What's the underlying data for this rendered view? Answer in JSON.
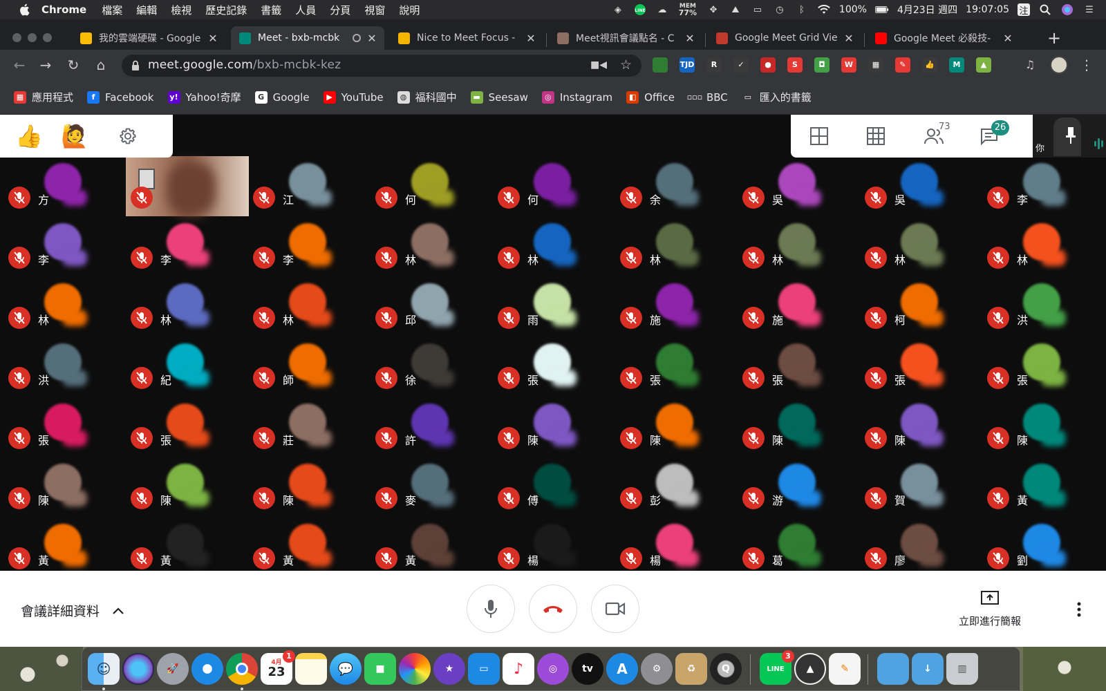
{
  "menubar": {
    "app": "Chrome",
    "items": [
      "檔案",
      "編輯",
      "檢視",
      "歷史記錄",
      "書籤",
      "人員",
      "分頁",
      "視窗",
      "說明"
    ],
    "mem_label": "MEM",
    "mem_value": "77%",
    "battery": "100%",
    "date": "4月23日 週四",
    "time": "19:07:05",
    "input_method": "注"
  },
  "tabs": [
    {
      "title": "我的雲端硬碟 - Google",
      "favicon_color": "#fbbc04"
    },
    {
      "title": "Meet - bxb-mcbk",
      "favicon_color": "#00897b",
      "active": true
    },
    {
      "title": "Nice to Meet Focus -",
      "favicon_color": "#f4b400"
    },
    {
      "title": "Meet視訊會議點名 - C",
      "favicon_color": "#8d6e63"
    },
    {
      "title": "Google Meet Grid Vie",
      "favicon_color": "#c0392b"
    },
    {
      "title": "Google Meet 必殺技-",
      "favicon_color": "#ff0000"
    }
  ],
  "omnibox": {
    "host": "meet.google.com",
    "path": "/bxb-mcbk-kez"
  },
  "extensions": [
    {
      "label": "",
      "color": "#2e7d32"
    },
    {
      "label": "TJD",
      "color": "#1565c0"
    },
    {
      "label": "R",
      "color": "#3a3a3a"
    },
    {
      "label": "✓",
      "color": "#3a3a3a"
    },
    {
      "label": "●",
      "color": "#c62828"
    },
    {
      "label": "S",
      "color": "#e53935"
    },
    {
      "label": "◘",
      "color": "#43a047"
    },
    {
      "label": "W",
      "color": "#e53935"
    },
    {
      "label": "▦",
      "color": "#3a3a3a"
    },
    {
      "label": "✎",
      "color": "#e53935"
    },
    {
      "label": "👍",
      "color": "#3a3a3a"
    },
    {
      "label": "M",
      "color": "#00897b"
    },
    {
      "label": "▲",
      "color": "#7cb342"
    }
  ],
  "bookmarks": [
    {
      "label": "應用程式",
      "icon_color": "#e53935",
      "glyph": "▦"
    },
    {
      "label": "Facebook",
      "icon_color": "#1877f2",
      "glyph": "f"
    },
    {
      "label": "Yahoo!奇摩",
      "icon_color": "#6001d2",
      "glyph": "y!"
    },
    {
      "label": "Google",
      "icon_color": "#ffffff",
      "glyph": "G"
    },
    {
      "label": "YouTube",
      "icon_color": "#ff0000",
      "glyph": "▶"
    },
    {
      "label": "福科國中",
      "icon_color": "#dddddd",
      "glyph": "◍"
    },
    {
      "label": "Seesaw",
      "icon_color": "#7cb342",
      "glyph": "▬"
    },
    {
      "label": "Instagram",
      "icon_color": "#c13584",
      "glyph": "◎"
    },
    {
      "label": "Office",
      "icon_color": "#d83b01",
      "glyph": "◧"
    },
    {
      "label": "BBC",
      "icon_color": "#35363a",
      "glyph": "▫▫▫"
    },
    {
      "label": "匯入的書籤",
      "icon_color": "#35363a",
      "glyph": "▭"
    }
  ],
  "meet": {
    "reactions": [
      "👍",
      "🙋"
    ],
    "participants_count": "73",
    "chat_count": "26",
    "self_label": "你",
    "participants": [
      [
        "方",
        "",
        "江",
        "何",
        "何",
        "余",
        "吳",
        "吳",
        "李"
      ],
      [
        "李",
        "李",
        "李",
        "林",
        "林",
        "林",
        "林",
        "林",
        "林"
      ],
      [
        "林",
        "林",
        "林",
        "邱",
        "雨",
        "施",
        "施",
        "柯",
        "洪"
      ],
      [
        "洪",
        "紀",
        "師",
        "徐",
        "張",
        "張",
        "張",
        "張",
        "張"
      ],
      [
        "張",
        "張",
        "莊",
        "許",
        "陳",
        "陳",
        "陳",
        "陳",
        "陳"
      ],
      [
        "陳",
        "陳",
        "陳",
        "麥",
        "傅",
        "彭",
        "游",
        "賀",
        "黃"
      ],
      [
        "黃",
        "黃",
        "黃",
        "黃",
        "楊",
        "楊",
        "葛",
        "廖",
        "劉"
      ]
    ],
    "avatar_colors": [
      [
        "#8e24aa",
        "#777777",
        "#78909c",
        "#9e9d24",
        "#7b1fa2",
        "#546e7a",
        "#ab47bc",
        "#1565c0",
        "#607d8b"
      ],
      [
        "#7e57c2",
        "#ec407a",
        "#ef6c00",
        "#8d6e63",
        "#1565c0",
        "#5a6b44",
        "#6b7a52",
        "#6b7a52",
        "#f4511e"
      ],
      [
        "#ef6c00",
        "#5c6bc0",
        "#e64a19",
        "#90a4ae",
        "#c5e1a5",
        "#8e24aa",
        "#ec407a",
        "#ef6c00",
        "#43a047"
      ],
      [
        "#546e7a",
        "#00acc1",
        "#ef6c00",
        "#3e3b36",
        "#e0f2f1",
        "#2e7d32",
        "#6d4c41",
        "#f4511e",
        "#7cb342"
      ],
      [
        "#d81b60",
        "#e64a19",
        "#8d6e63",
        "#5e35b1",
        "#7e57c2",
        "#ef6c00",
        "#00695c",
        "#7e57c2",
        "#00897b"
      ],
      [
        "#8d6e63",
        "#7cb342",
        "#e64a19",
        "#546e7a",
        "#004d40",
        "#bdbdbd",
        "#1e88e5",
        "#78909c",
        "#00897b"
      ],
      [
        "#ef6c00",
        "#222222",
        "#e64a19",
        "#5d4037",
        "#1a1a1a",
        "#ec407a",
        "#2e7d32",
        "#6d4c41",
        "#1e88e5"
      ]
    ]
  },
  "controls": {
    "details_label": "會議詳細資料",
    "present_label": "立即進行簡報"
  },
  "dock": {
    "calendar_month": "4月",
    "calendar_day": "23",
    "calendar_badge": "1",
    "line_badge": "3",
    "line_label": "LINE",
    "appletv_label": "tv"
  }
}
